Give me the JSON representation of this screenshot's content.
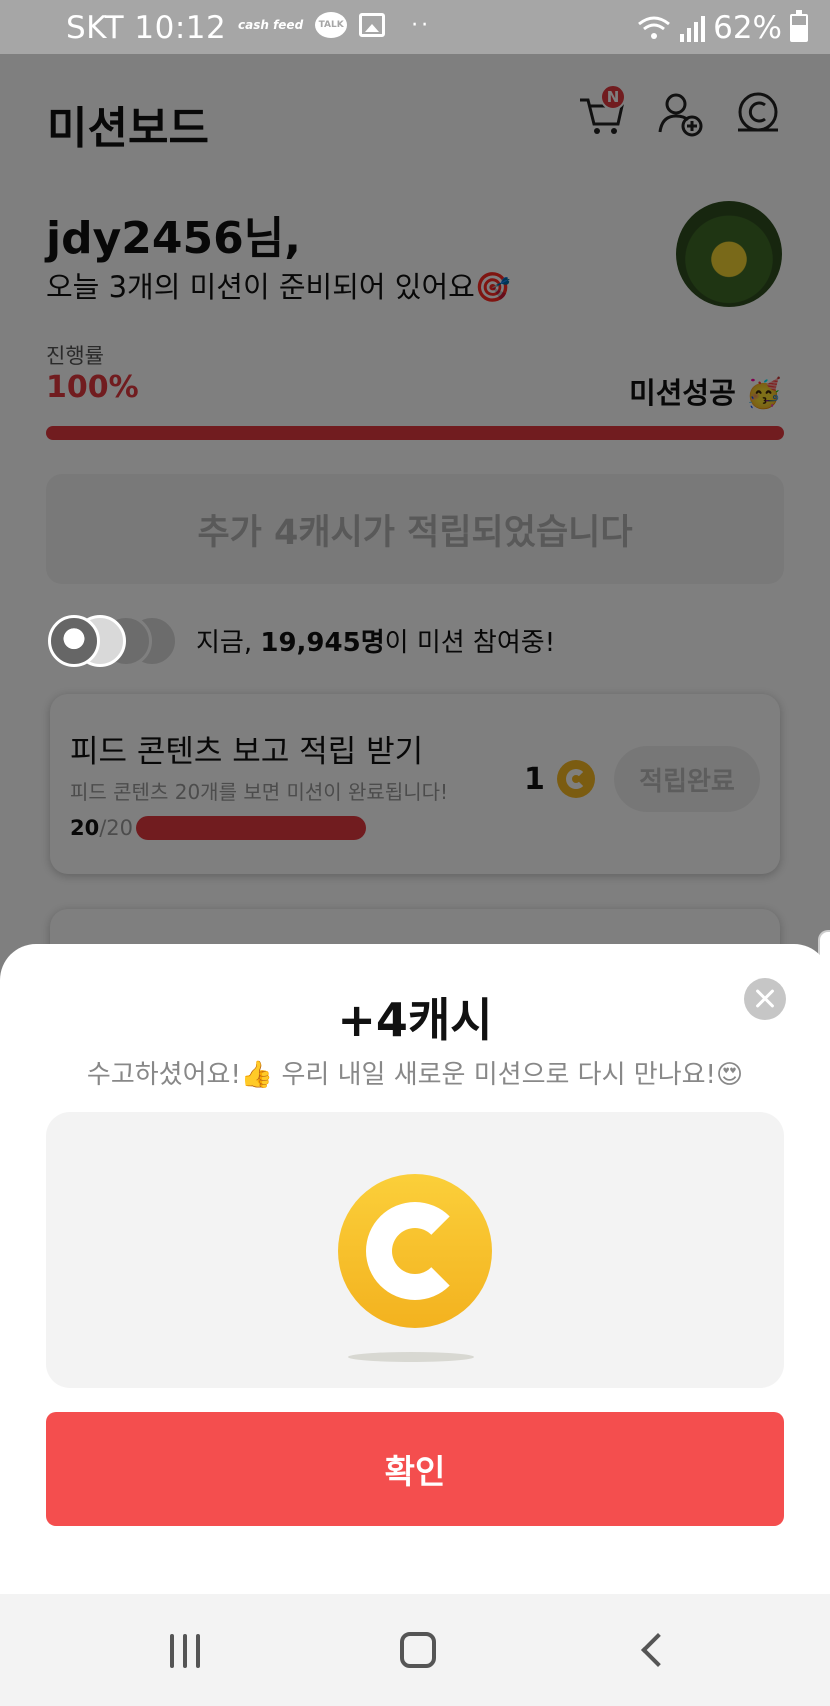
{
  "status_bar": {
    "carrier_time": "SKT 10:12",
    "cashfeed_icon": "cash feed",
    "talk_icon": "TALK",
    "dots": "··",
    "battery": "62%"
  },
  "header": {
    "title": "미션보드",
    "cart_badge": "N",
    "icons": [
      "cart-icon",
      "add-friend-icon",
      "coin-icon"
    ]
  },
  "greeting": {
    "user": "jdy2456님,",
    "subtitle": "오늘 3개의 미션이 준비되어 있어요🎯"
  },
  "progress": {
    "label": "진행률",
    "value": "100%",
    "fraction": 1.0,
    "status": "미션성공 🥳"
  },
  "extra_banner": "추가 4캐시가 적립되었습니다",
  "participants": {
    "prefix": "지금, ",
    "count": "19,945명",
    "suffix": "이 미션 참여중!"
  },
  "mission": {
    "title": "피드 콘텐츠 보고 적립 받기",
    "description": "피드 콘텐츠 20개를 보면 미션이 완료됩니다!",
    "count_done": "20",
    "count_total": "/20",
    "progress": 1.0,
    "reward": "1",
    "button": "적립완료"
  },
  "sheet": {
    "title": "+4캐시",
    "message": "수고하셨어요!👍 우리 내일 새로운 미션으로 다시 만나요!😍",
    "confirm": "확인"
  },
  "colors": {
    "accent": "#e2383f",
    "confirm": "#f44e4e",
    "coin": "#f6b823"
  }
}
